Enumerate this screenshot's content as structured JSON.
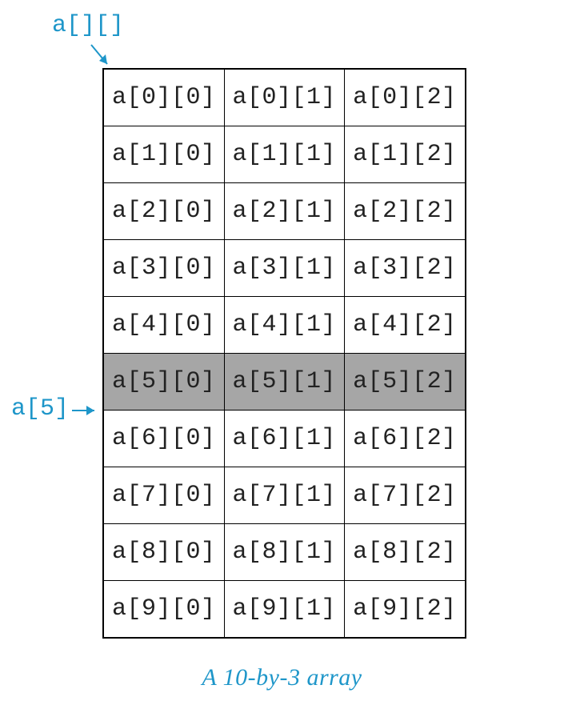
{
  "labels": {
    "array_label": "a[][]",
    "row_label": "a[5]",
    "caption": "A 10-by-3 array"
  },
  "colors": {
    "accent": "#1E96C9",
    "highlight_bg": "#a6a6a6"
  },
  "grid": {
    "rows": 10,
    "cols": 3,
    "highlight_row_index": 5,
    "cells": [
      [
        "a[0][0]",
        "a[0][1]",
        "a[0][2]"
      ],
      [
        "a[1][0]",
        "a[1][1]",
        "a[1][2]"
      ],
      [
        "a[2][0]",
        "a[2][1]",
        "a[2][2]"
      ],
      [
        "a[3][0]",
        "a[3][1]",
        "a[3][2]"
      ],
      [
        "a[4][0]",
        "a[4][1]",
        "a[4][2]"
      ],
      [
        "a[5][0]",
        "a[5][1]",
        "a[5][2]"
      ],
      [
        "a[6][0]",
        "a[6][1]",
        "a[6][2]"
      ],
      [
        "a[7][0]",
        "a[7][1]",
        "a[7][2]"
      ],
      [
        "a[8][0]",
        "a[8][1]",
        "a[8][2]"
      ],
      [
        "a[9][0]",
        "a[9][1]",
        "a[9][2]"
      ]
    ]
  },
  "chart_data": {
    "type": "table",
    "title": "A 10-by-3 array",
    "rows": 10,
    "cols": 3,
    "highlighted_row": 5,
    "array_label": "a[][]",
    "row_label": "a[5]",
    "cells": [
      [
        "a[0][0]",
        "a[0][1]",
        "a[0][2]"
      ],
      [
        "a[1][0]",
        "a[1][1]",
        "a[1][2]"
      ],
      [
        "a[2][0]",
        "a[2][1]",
        "a[2][2]"
      ],
      [
        "a[3][0]",
        "a[3][1]",
        "a[3][2]"
      ],
      [
        "a[4][0]",
        "a[4][1]",
        "a[4][2]"
      ],
      [
        "a[5][0]",
        "a[5][1]",
        "a[5][2]"
      ],
      [
        "a[6][0]",
        "a[6][1]",
        "a[6][2]"
      ],
      [
        "a[7][0]",
        "a[7][1]",
        "a[7][2]"
      ],
      [
        "a[8][0]",
        "a[8][1]",
        "a[8][2]"
      ],
      [
        "a[9][0]",
        "a[9][1]",
        "a[9][2]"
      ]
    ]
  }
}
